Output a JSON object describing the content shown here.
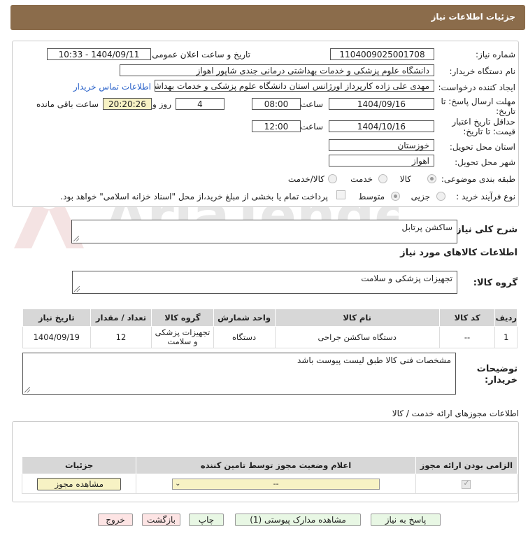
{
  "title": "جزئیات اطلاعات نیاز",
  "fields": {
    "need_number_label": "شماره نیاز:",
    "need_number": "1104009025001708",
    "announce_label": "تاریخ و ساعت اعلان عمومی:",
    "announce_value": "1404/09/11 - 10:33",
    "buyer_org_label": "نام دستگاه خریدار:",
    "buyer_org": "دانشگاه علوم پزشکی و خدمات بهداشتی درمانی جندی شاپور اهواز",
    "requester_label": "ایجاد کننده درخواست:",
    "requester": "مهدی علی زاده کارپرداز اورژانس استان دانشگاه علوم پزشکی و خدمات بهداشتی",
    "contact_link": "اطلاعات تماس خریدار",
    "deadline_label": "مهلت ارسال پاسخ: تا تاریخ:",
    "deadline_date": "1404/09/16",
    "time_label": "ساعت",
    "deadline_time": "08:00",
    "days": "4",
    "days_label": "روز و",
    "remaining": "20:20:26",
    "remaining_label": "ساعت باقی مانده",
    "validity_label": "حداقل تاریخ اعتبار قیمت: تا تاریخ:",
    "validity_date": "1404/10/16",
    "validity_time_label": "ساعت",
    "validity_time": "12:00",
    "province_label": "استان محل تحویل:",
    "province": "خوزستان",
    "city_label": "شهر محل تحویل:",
    "city": "اهواز",
    "category_label": "طبقه بندی موضوعی:",
    "cat_goods": "کالا",
    "cat_service": "خدمت",
    "cat_both": "کالا/خدمت",
    "process_label": "نوع فرآیند خرید :",
    "proc_partial": "جزیی",
    "proc_medium": "متوسط",
    "payment_note": "پرداخت تمام یا بخشی از مبلغ خرید،از محل \"اسناد خزانه اسلامی\" خواهد بود."
  },
  "summary": {
    "label": "شرح کلی نیاز:",
    "value": "ساکشن پرتابل"
  },
  "goods_info_title": "اطلاعات کالاهای مورد نیاز",
  "goods_group": {
    "label": "گروه کالا:",
    "value": "تجهیزات پزشکی و سلامت"
  },
  "items_table": {
    "headers": [
      "ردیف",
      "کد کالا",
      "نام کالا",
      "واحد شمارش",
      "گروه کالا",
      "تعداد / مقدار",
      "تاریخ نیاز"
    ],
    "rows": [
      [
        "1",
        "--",
        "دستگاه ساکشن جراحی",
        "دستگاه",
        "تجهیزات پزشکی و سلامت",
        "12",
        "1404/09/19"
      ]
    ]
  },
  "buyer_notes": {
    "label": "توضیحات خریدار:",
    "value": "مشخصات فنی کالا طبق لیست پیوست باشد"
  },
  "permits": {
    "title": "اطلاعات مجوزهای ارائه خدمت / کالا",
    "headers": [
      "الزامی بودن ارائه مجوز",
      "اعلام وضعیت مجوز توسط تامین کننده",
      "جزئیات"
    ],
    "select_value": "--",
    "view_button": "مشاهده مجوز"
  },
  "buttons": {
    "reply": "پاسخ به نیاز",
    "attachments": "مشاهده مدارک پیوستی (1)",
    "print": "چاپ",
    "back": "بازگشت",
    "exit": "خروج"
  },
  "colors": {
    "title_bg": "#8b6c4b",
    "yellow_field": "#f7f2c4",
    "link": "#2a62c9",
    "green_button": "#e8f7e4",
    "pink_button": "#fde4e4"
  }
}
